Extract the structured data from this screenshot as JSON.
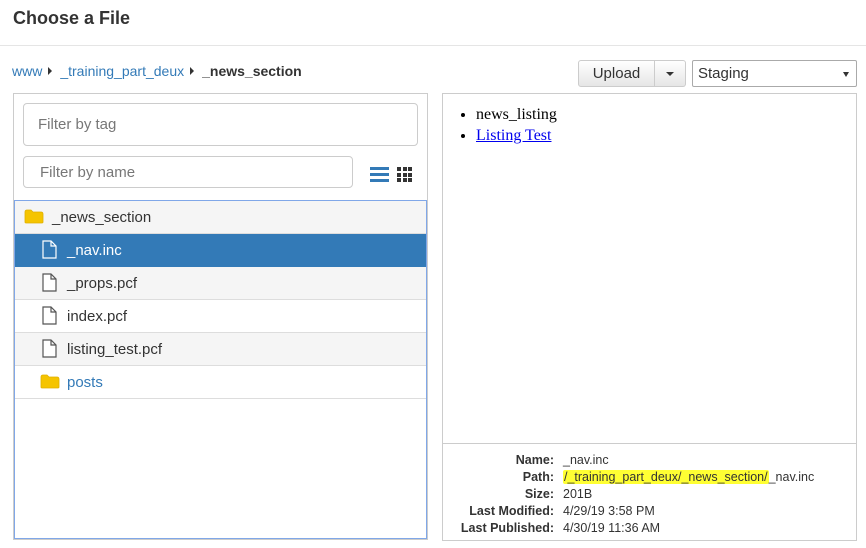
{
  "dialog": {
    "title": "Choose a File"
  },
  "breadcrumb": {
    "items": [
      "www",
      "_training_part_deux"
    ],
    "current": "_news_section"
  },
  "toolbar": {
    "upload_label": "Upload",
    "environment": "Staging"
  },
  "filters": {
    "tag_placeholder": "Filter by tag",
    "name_placeholder": "Filter by name"
  },
  "files": [
    {
      "name": "_news_section",
      "type": "folder"
    },
    {
      "name": "_nav.inc",
      "type": "file"
    },
    {
      "name": "_props.pcf",
      "type": "file"
    },
    {
      "name": "index.pcf",
      "type": "file"
    },
    {
      "name": "listing_test.pcf",
      "type": "file"
    },
    {
      "name": "posts",
      "type": "folder"
    }
  ],
  "preview": {
    "items": [
      "news_listing",
      "Listing Test"
    ]
  },
  "details": {
    "name_label": "Name:",
    "name_value": "_nav.inc",
    "path_label": "Path:",
    "path_highlight": "/_training_part_deux/_news_section/",
    "path_rest": "_nav.inc",
    "size_label": "Size:",
    "size_value": "201B",
    "modified_label": "Last Modified:",
    "modified_value": "4/29/19 3:58 PM",
    "published_label": "Last Published:",
    "published_value": "4/30/19 11:36 AM"
  },
  "colors": {
    "selected": "#337ab7",
    "folder": "#f5c400",
    "link": "#337ab7",
    "highlight": "#ffff33"
  }
}
